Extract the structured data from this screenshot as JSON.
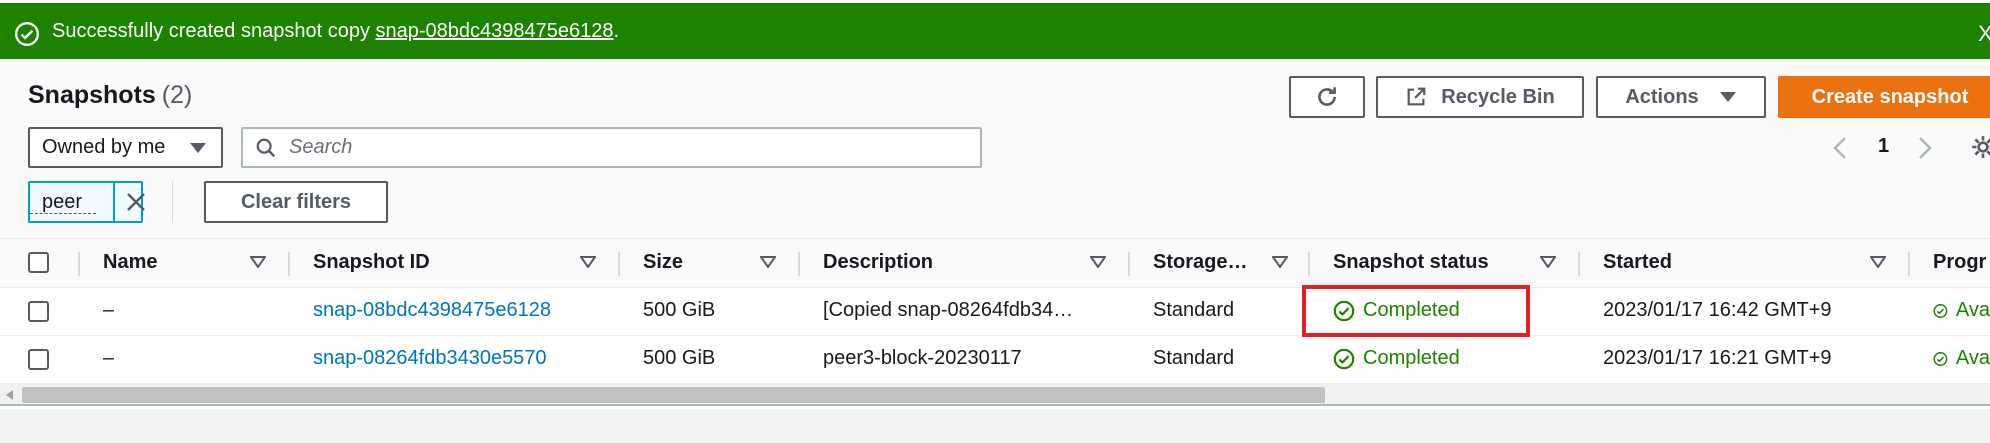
{
  "flash": {
    "message_prefix": "Successfully created snapshot copy ",
    "snapshot_link": "snap-08bdc4398475e6128",
    "message_suffix": ".",
    "dismiss": "X"
  },
  "header": {
    "title": "Snapshots",
    "count": "(2)",
    "recycle_bin_label": "Recycle Bin",
    "actions_label": "Actions",
    "create_label": "Create snapshot"
  },
  "filters": {
    "owner_selected": "Owned by me",
    "search_placeholder": "Search",
    "token_label": "peer",
    "clear_label": "Clear filters"
  },
  "pagination": {
    "current_page": "1"
  },
  "table": {
    "columns": [
      "Name",
      "Snapshot ID",
      "Size",
      "Description",
      "Storage…",
      "Snapshot status",
      "Started",
      "Progr"
    ],
    "rows": [
      {
        "name": "–",
        "snapshot_id": "snap-08bdc4398475e6128",
        "size": "500 GiB",
        "description": "[Copied snap-08264fdb34…",
        "storage": "Standard",
        "status": "Completed",
        "started": "2023/01/17 16:42 GMT+9",
        "progress": "Ava"
      },
      {
        "name": "–",
        "snapshot_id": "snap-08264fdb3430e5570",
        "size": "500 GiB",
        "description": "peer3-block-20230117",
        "storage": "Standard",
        "status": "Completed",
        "started": "2023/01/17 16:21 GMT+9",
        "progress": "Ava"
      }
    ]
  },
  "colors": {
    "success": "#1d8102",
    "link": "#0073bb",
    "primary": "#ec7211",
    "highlight": "#e0202a"
  }
}
